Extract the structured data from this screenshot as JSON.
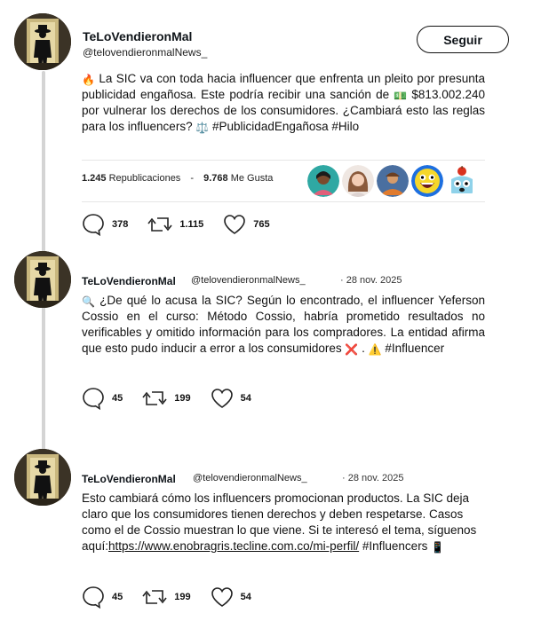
{
  "tweets": [
    {
      "author_name": "TeLoVendieronMal",
      "handle": "@telovendieronmalNews_",
      "follow_label": "Seguir",
      "text_parts": {
        "emoji1": "🔥",
        "body": " La SIC va con toda hacia influencer que enfrenta un pleito por presunta publicidad engañosa. Este podría recibir una sanción de ",
        "emoji2": "💵",
        "body2": " $813.002.240 por vulnerar los derechos de los consumidores. ¿Cambiará esto las reglas para los influencers? ",
        "emoji3": "⚖️",
        "body3": " #PublicidadEngañosa #Hilo"
      },
      "reposts_count": "1.245",
      "reposts_label": "Republicaciones",
      "stats_sep": "-",
      "likes_count": "9.768",
      "likes_label": "Me Gusta",
      "replies": "378",
      "retweets": "1.115",
      "hearts": "765"
    },
    {
      "author_name": "TeLoVendieronMal",
      "handle": "@telovendieronmalNews_",
      "date": "· 28 nov. 2025",
      "text_parts": {
        "emoji1": "🔍",
        "body": " ¿De qué lo acusa la SIC? Según lo encontrado, el influencer Yeferson Cossio en el curso: Método Cossio, habría prometido resultados no verificables y omitido información para los compradores. La entidad afirma que esto pudo inducir a error a los consumidores ",
        "emoji2": "❌",
        "body2": " . ",
        "emoji3": "⚠️",
        "body3": " #Influencer"
      },
      "replies": "45",
      "retweets": "199",
      "hearts": "54"
    },
    {
      "author_name": "TeLoVendieronMal",
      "handle": "@telovendieronmalNews_",
      "date": "· 28 nov. 2025",
      "text_parts": {
        "body": "Esto cambiará cómo los influencers promocionan productos. La SIC deja claro que los consumidores tienen derechos y deben respetarse. Casos como el de Cossio muestran lo que viene. Si te interesó el tema, síguenos aquí:",
        "link": "https://www.enobragris.tecline.com.co/mi-perfil/",
        "body2": " #Influencers ",
        "emoji1": "📱"
      },
      "replies": "45",
      "retweets": "199",
      "hearts": "54"
    }
  ],
  "liker_icons": [
    "avatar-woman-icon",
    "avatar-girl-icon",
    "avatar-group-icon",
    "awesome-face-icon",
    "apple-face-icon"
  ],
  "colors": {
    "thread_line": "#d4d4d4",
    "divider": "#e6e6e6",
    "text": "#0f1419"
  }
}
